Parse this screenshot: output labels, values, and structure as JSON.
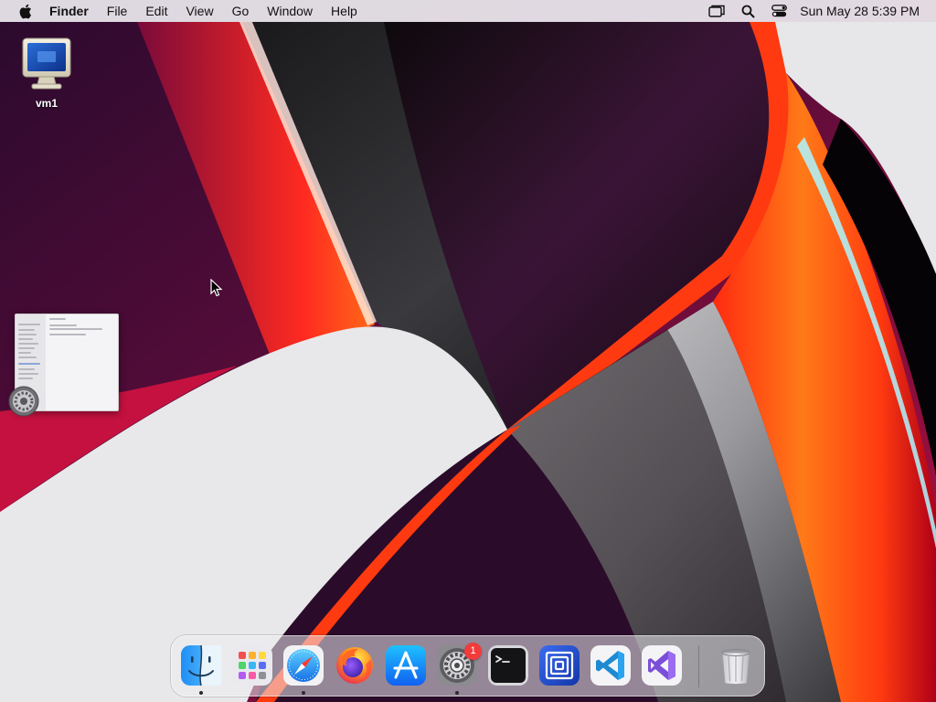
{
  "menubar": {
    "app_name": "Finder",
    "menus": [
      "File",
      "Edit",
      "View",
      "Go",
      "Window",
      "Help"
    ],
    "clock": "Sun May 28  5:39 PM",
    "status_icons": [
      "display-mirroring-icon",
      "spotlight-search-icon",
      "control-center-icon"
    ]
  },
  "desktop": {
    "icons": [
      {
        "label": "vm1",
        "icon": "monitor-icon"
      }
    ]
  },
  "dock": {
    "apps": [
      {
        "name": "Finder",
        "icon": "finder-icon",
        "running": true
      },
      {
        "name": "Launchpad",
        "icon": "launchpad-icon",
        "running": false
      },
      {
        "name": "Safari",
        "icon": "safari-icon",
        "running": true
      },
      {
        "name": "Firefox",
        "icon": "firefox-icon",
        "running": false
      },
      {
        "name": "App Store",
        "icon": "app-store-icon",
        "running": false
      },
      {
        "name": "System Preferences",
        "icon": "system-preferences-icon",
        "running": true,
        "badge": "1"
      },
      {
        "name": "Terminal",
        "icon": "terminal-icon",
        "running": false
      },
      {
        "name": "Parallels",
        "icon": "parallels-icon",
        "running": false
      },
      {
        "name": "Visual Studio Code",
        "icon": "vscode-icon",
        "running": false
      },
      {
        "name": "Visual Studio",
        "icon": "visual-studio-icon",
        "running": false
      }
    ],
    "trash": {
      "name": "Trash",
      "icon": "trash-icon"
    }
  },
  "colors": {
    "menubar_bg": "#ECE9EE",
    "badge_red": "#F23B3B",
    "wallpaper_orange": "#FF4A10",
    "wallpaper_magenta": "#C0104A"
  }
}
